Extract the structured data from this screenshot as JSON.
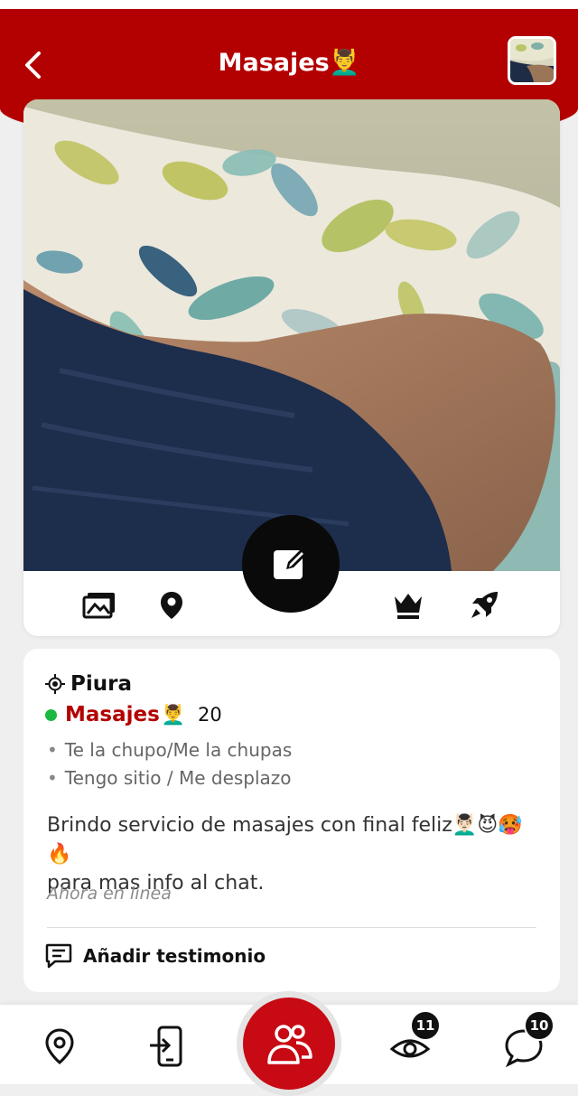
{
  "header": {
    "title": "Masajes",
    "title_emoji": "💆‍♂️",
    "back_icon": "chevron-left-icon",
    "avatar": "profile-thumbnail"
  },
  "photo_card": {
    "icons": [
      "gallery-icon",
      "location-pin-icon",
      "edit-icon",
      "crown-icon",
      "rocket-icon"
    ]
  },
  "profile": {
    "city": "Piura",
    "category": "Masajes",
    "category_emoji": "💆‍♂️",
    "age": "20",
    "online_dot_color": "#1db83f",
    "tags": [
      "Te la chupo/Me la chupas",
      "Tengo sitio / Me desplazo"
    ],
    "description_line1": "Brindo servicio de masajes con final feliz💆🏻‍♂️😈🥵🔥",
    "description_line2": "para mas info al chat.",
    "status": "Ahora en linea",
    "testimonial_label": "Añadir testimonio"
  },
  "bottom_nav": {
    "items": [
      {
        "icon": "location-pin-icon"
      },
      {
        "icon": "phone-login-icon"
      },
      {
        "icon": "users-icon"
      },
      {
        "icon": "eye-icon",
        "badge": "11"
      },
      {
        "icon": "chat-bubble-icon",
        "badge": "10"
      }
    ]
  },
  "colors": {
    "accent": "#b30000",
    "fab": "#c70a14",
    "category": "#b30000"
  }
}
